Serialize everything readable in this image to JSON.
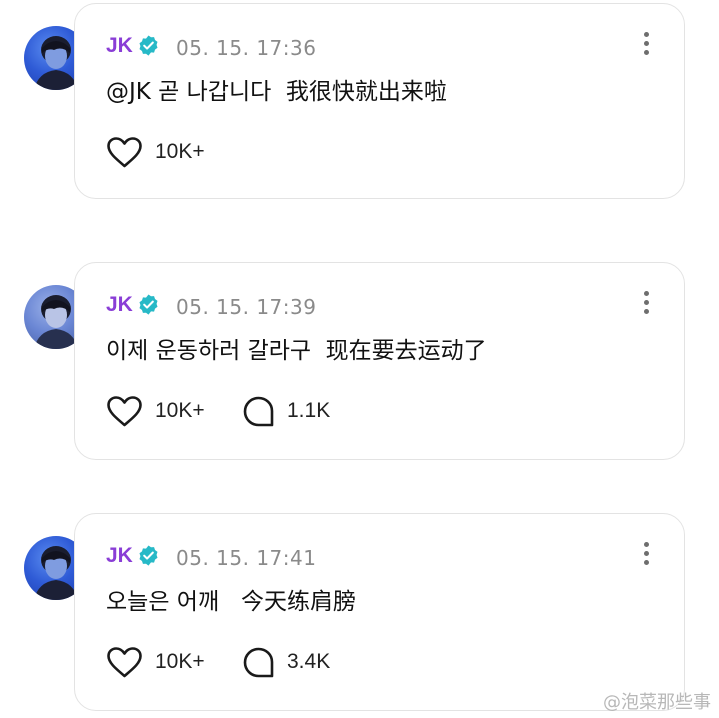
{
  "colors": {
    "username": "#8a3ed6",
    "verified_badge": "#27b9c7",
    "timestamp": "#8a8a8a",
    "text": "#111111",
    "card_border": "#e3e3e3"
  },
  "posts": [
    {
      "author": "JK",
      "verified_icon": "verified-badge-icon",
      "timestamp": "05. 15. 17:36",
      "content": "@JK 곧 나갑니다  我很快就出来啦",
      "likes": "10K+",
      "comments": null
    },
    {
      "author": "JK",
      "verified_icon": "verified-badge-icon",
      "timestamp": "05. 15. 17:39",
      "content": "이제 운동하러 갈라구  现在要去运动了",
      "likes": "10K+",
      "comments": "1.1K"
    },
    {
      "author": "JK",
      "verified_icon": "verified-badge-icon",
      "timestamp": "05. 15. 17:41",
      "content": "오늘은 어깨   今天练肩膀",
      "likes": "10K+",
      "comments": "3.4K"
    }
  ],
  "watermark": "@泡菜那些事"
}
